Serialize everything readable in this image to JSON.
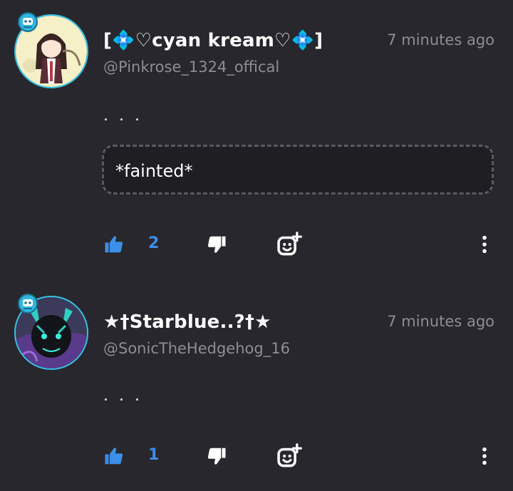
{
  "colors": {
    "background": "#28272d",
    "accent_blue": "#3b8fe8",
    "muted_text": "#8e8d94",
    "avatar_ring": "#37c3e7"
  },
  "comments": [
    {
      "username": "[💠♡cyan kream♡💠]",
      "handle": "@Pinkrose_1324_offical",
      "timestamp": "7 minutes ago",
      "body": ". . .",
      "quote": "*fainted*",
      "like_count": "2",
      "icons": {
        "like": "thumbs-up-icon",
        "dislike": "thumbs-down-icon",
        "react": "add-reaction-icon",
        "more": "more-vertical-icon"
      }
    },
    {
      "username": "★†Starblue..?†★",
      "handle": "@SonicTheHedgehog_16",
      "timestamp": "7 minutes ago",
      "body": ". . .",
      "like_count": "1",
      "icons": {
        "like": "thumbs-up-icon",
        "dislike": "thumbs-down-icon",
        "react": "add-reaction-icon",
        "more": "more-vertical-icon"
      }
    }
  ]
}
